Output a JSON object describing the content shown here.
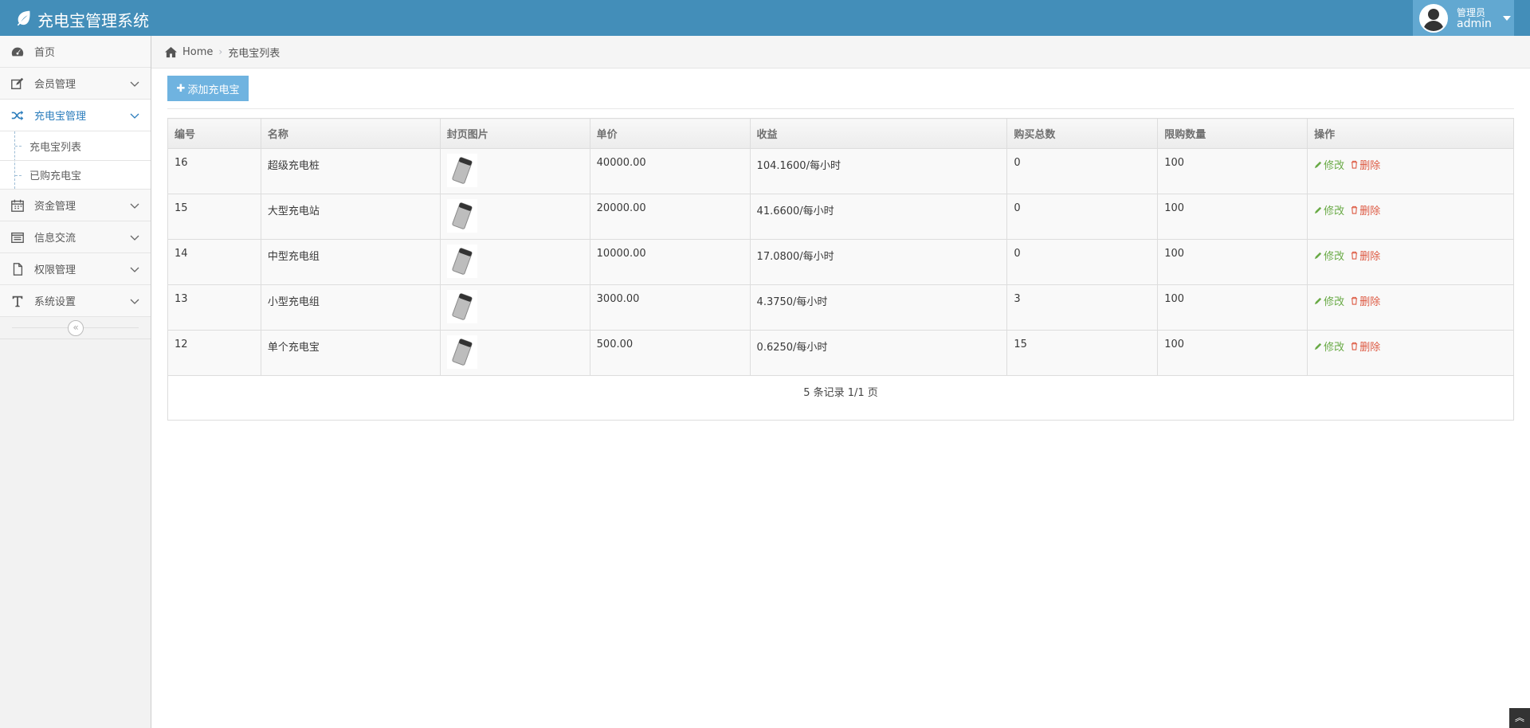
{
  "app": {
    "title": "充电宝管理系统"
  },
  "user": {
    "welcome": "管理员",
    "name": "admin"
  },
  "sidebar": {
    "items": [
      {
        "label": "首页",
        "icon": "dashboard-icon"
      },
      {
        "label": "会员管理",
        "icon": "edit-icon"
      },
      {
        "label": "充电宝管理",
        "icon": "random-icon",
        "active": true,
        "children": [
          {
            "label": "充电宝列表"
          },
          {
            "label": "已购充电宝"
          }
        ]
      },
      {
        "label": "资金管理",
        "icon": "calendar-icon"
      },
      {
        "label": "信息交流",
        "icon": "list-icon"
      },
      {
        "label": "权限管理",
        "icon": "file-icon"
      },
      {
        "label": "系统设置",
        "icon": "text-icon"
      }
    ],
    "collapse_glyph": "«"
  },
  "breadcrumb": {
    "home": "Home",
    "current": "充电宝列表"
  },
  "toolbar": {
    "add_label": "添加充电宝"
  },
  "table": {
    "headers": [
      "编号",
      "名称",
      "封页图片",
      "单价",
      "收益",
      "购买总数",
      "限购数量",
      "操作"
    ],
    "rows": [
      {
        "id": "16",
        "name": "超级充电桩",
        "price": "40000.00",
        "income": "104.1600/每小时",
        "bought": "0",
        "limit": "100"
      },
      {
        "id": "15",
        "name": "大型充电站",
        "price": "20000.00",
        "income": "41.6600/每小时",
        "bought": "0",
        "limit": "100"
      },
      {
        "id": "14",
        "name": "中型充电组",
        "price": "10000.00",
        "income": "17.0800/每小时",
        "bought": "0",
        "limit": "100"
      },
      {
        "id": "13",
        "name": "小型充电组",
        "price": "3000.00",
        "income": "4.3750/每小时",
        "bought": "3",
        "limit": "100"
      },
      {
        "id": "12",
        "name": "单个充电宝",
        "price": "500.00",
        "income": "0.6250/每小时",
        "bought": "15",
        "limit": "100"
      }
    ],
    "edit_label": "修改",
    "delete_label": "删除",
    "pagination": "5 条记录 1/1 页"
  },
  "colors": {
    "navbar": "#438eb9",
    "user_box": "#62a8d1",
    "add_button": "#6fb3e0",
    "edit": "#69aa46",
    "delete": "#dd5a43",
    "active_nav": "#2b7dbc"
  }
}
